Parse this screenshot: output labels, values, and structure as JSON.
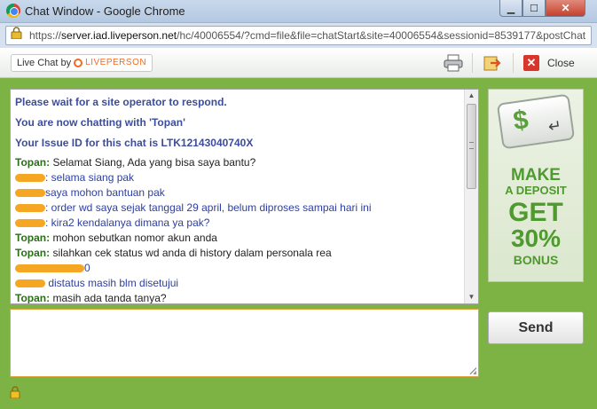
{
  "window": {
    "title": "Chat Window - Google Chrome",
    "url_prefix": "https://",
    "url_host": "server.iad.liveperson.net",
    "url_rest": "/hc/40006554/?cmd=file&file=chatStart&site=40006554&sessionid=8539177&postChat"
  },
  "toolbar": {
    "badge_text": "Live Chat by",
    "badge_brand": "LIVEPERSON",
    "close_label": "Close"
  },
  "transcript": {
    "system_messages": [
      "Please wait for a site operator to respond.",
      "You are now chatting with 'Topan'",
      "Your Issue ID for this chat is LTK12143040740X"
    ],
    "lines": [
      {
        "who": "operator",
        "name": "Topan:",
        "text": "Selamat Siang,  Ada yang bisa saya bantu?"
      },
      {
        "who": "user",
        "name": "",
        "text": ": selama siang pak"
      },
      {
        "who": "user",
        "name": "",
        "text": "saya mohon bantuan pak"
      },
      {
        "who": "user",
        "name": "",
        "text": ": order wd saya sejak tanggal 29 april, belum diproses sampai hari ini"
      },
      {
        "who": "user",
        "name": "",
        "text": ": kira2 kendalanya dimana ya pak?"
      },
      {
        "who": "operator",
        "name": "Topan:",
        "text": "mohon sebutkan nomor akun anda"
      },
      {
        "who": "operator",
        "name": "Topan:",
        "text": "silahkan cek status wd anda di history dalam personala rea"
      },
      {
        "who": "user",
        "name": "",
        "text": "0"
      },
      {
        "who": "user",
        "name": "",
        "text": "distatus masih blm disetujui"
      },
      {
        "who": "operator",
        "name": "Topan:",
        "text": "masih ada tanda tanya?"
      }
    ]
  },
  "ad": {
    "key_symbol": "$",
    "line1": "MAKE",
    "line2": "A DEPOSIT",
    "line3": "GET",
    "line4": "30%",
    "line5": "BONUS"
  },
  "compose": {
    "value": "",
    "send_label": "Send"
  },
  "colors": {
    "frame_green": "#7db244",
    "system_text": "#3b4d9b",
    "operator_name": "#2c6d18",
    "user_text": "#2d3fa0",
    "redaction": "#f5a623",
    "input_border": "#e0a33a"
  }
}
